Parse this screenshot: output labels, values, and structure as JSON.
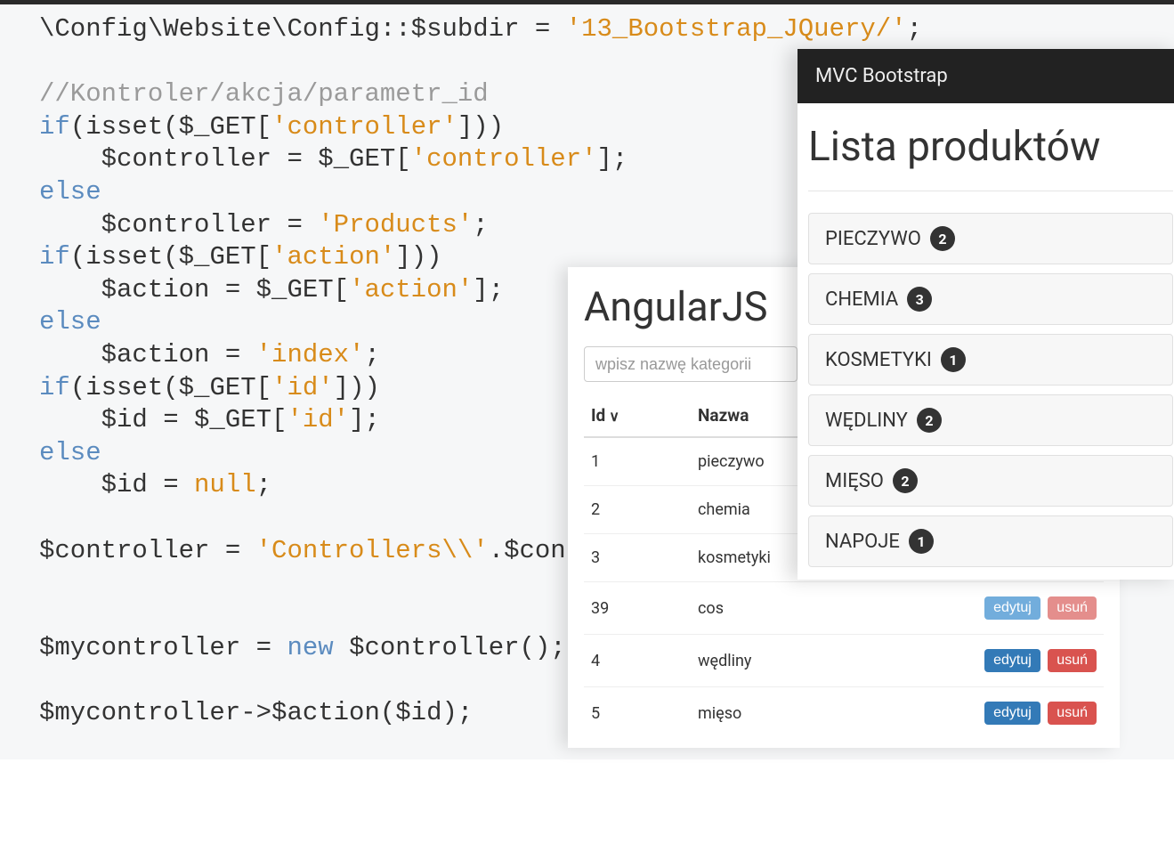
{
  "code": {
    "line1_pre": "\\Config\\Website\\Config::$subdir = ",
    "line1_str": "'13_Bootstrap_JQuery/'",
    "line1_post": ";",
    "line3_cmt": "//Kontroler/akcja/parametr_id",
    "if": "if",
    "else": "else",
    "new": "new",
    "null": "null",
    "l4a": "(isset($_GET[",
    "l4b": "'controller'",
    "l4c": "]))",
    "l5a": "    $controller = $_GET[",
    "l5b": "'controller'",
    "l5c": "];",
    "l7a": "    $controller = ",
    "l7b": "'Products'",
    "l7c": ";",
    "l8a": "(isset($_GET[",
    "l8b": "'action'",
    "l8c": "]))",
    "l9a": "    $action = $_GET[",
    "l9b": "'action'",
    "l9c": "];",
    "l11a": "    $action = ",
    "l11b": "'index'",
    "l11c": ";",
    "l12a": "(isset($_GET[",
    "l12b": "'id'",
    "l12c": "]))",
    "l13a": "    $id = $_GET[",
    "l13b": "'id'",
    "l13c": "];",
    "l15a": "    $id = ",
    "l15c": ";",
    "l17a": "$controller = ",
    "l17b": "'Controllers\\\\'",
    "l17c": ".$controller;",
    "l20a": "$mycontroller = ",
    "l20c": " $controller();",
    "l22": "$mycontroller->$action($id);"
  },
  "angular": {
    "title": "AngularJS",
    "search_placeholder": "wpisz nazwę kategorii",
    "col_id": "Id",
    "col_name": "Nazwa",
    "btn_edit": "edytuj",
    "btn_del": "usuń",
    "rows": [
      {
        "id": "1",
        "name": "pieczywo"
      },
      {
        "id": "2",
        "name": "chemia"
      },
      {
        "id": "3",
        "name": "kosmetyki"
      },
      {
        "id": "39",
        "name": "cos"
      },
      {
        "id": "4",
        "name": "wędliny"
      },
      {
        "id": "5",
        "name": "mięso"
      }
    ]
  },
  "mvc": {
    "brand": "MVC Bootstrap",
    "heading": "Lista produktów",
    "items": [
      {
        "label": "PIECZYWO",
        "count": "2"
      },
      {
        "label": "CHEMIA",
        "count": "3"
      },
      {
        "label": "KOSMETYKI",
        "count": "1"
      },
      {
        "label": "WĘDLINY",
        "count": "2"
      },
      {
        "label": "MIĘSO",
        "count": "2"
      },
      {
        "label": "NAPOJE",
        "count": "1"
      }
    ]
  }
}
